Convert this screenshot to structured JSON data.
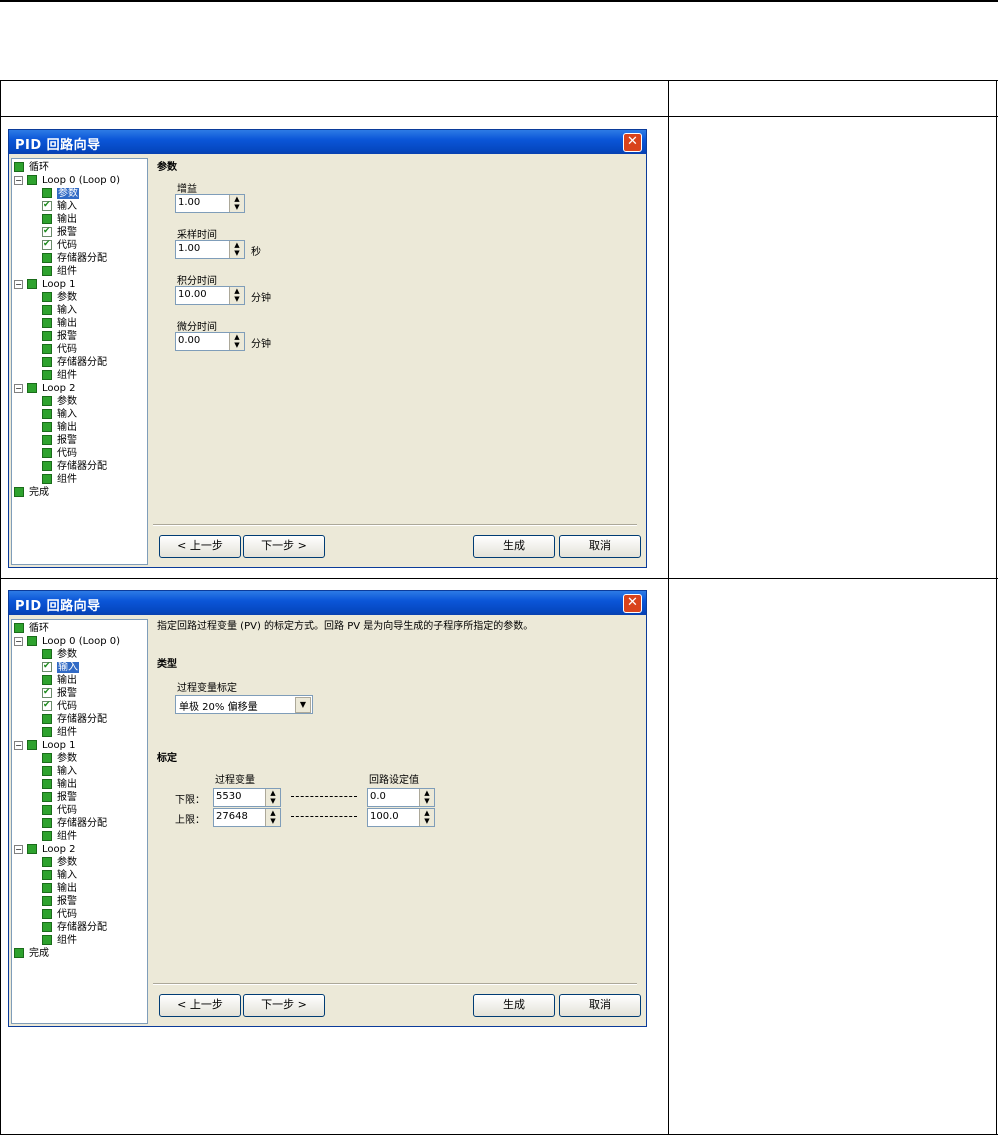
{
  "window_title": "PID 回路向导",
  "tree": {
    "root_cycle": "循环",
    "loop0": "Loop 0 (Loop 0)",
    "loop1": "Loop 1",
    "loop2": "Loop 2",
    "finish": "完成",
    "children": [
      "参数",
      "输入",
      "输出",
      "报警",
      "代码",
      "存储器分配",
      "组件"
    ]
  },
  "panel1": {
    "section": "参数",
    "gain_label": "增益",
    "gain_value": "1.00",
    "sample_label": "采样时间",
    "sample_value": "1.00",
    "sample_unit": "秒",
    "integral_label": "积分时间",
    "integral_value": "10.00",
    "integral_unit": "分钟",
    "derivative_label": "微分时间",
    "derivative_value": "0.00",
    "derivative_unit": "分钟"
  },
  "panel2": {
    "intro": "指定回路过程变量 (PV) 的标定方式。回路 PV 是为向导生成的子程序所指定的参数。",
    "type_section": "类型",
    "scaling_label": "过程变量标定",
    "scaling_value": "单极 20% 偏移量",
    "scale_section": "标定",
    "pv_header": "过程变量",
    "sp_header": "回路设定值",
    "low_label": "下限：",
    "low_pv": "5530",
    "low_sp": "0.0",
    "high_label": "上限：",
    "high_pv": "27648",
    "high_sp": "100.0"
  },
  "buttons": {
    "prev": "< 上一步",
    "next": "下一步 >",
    "generate": "生成",
    "cancel": "取消"
  }
}
